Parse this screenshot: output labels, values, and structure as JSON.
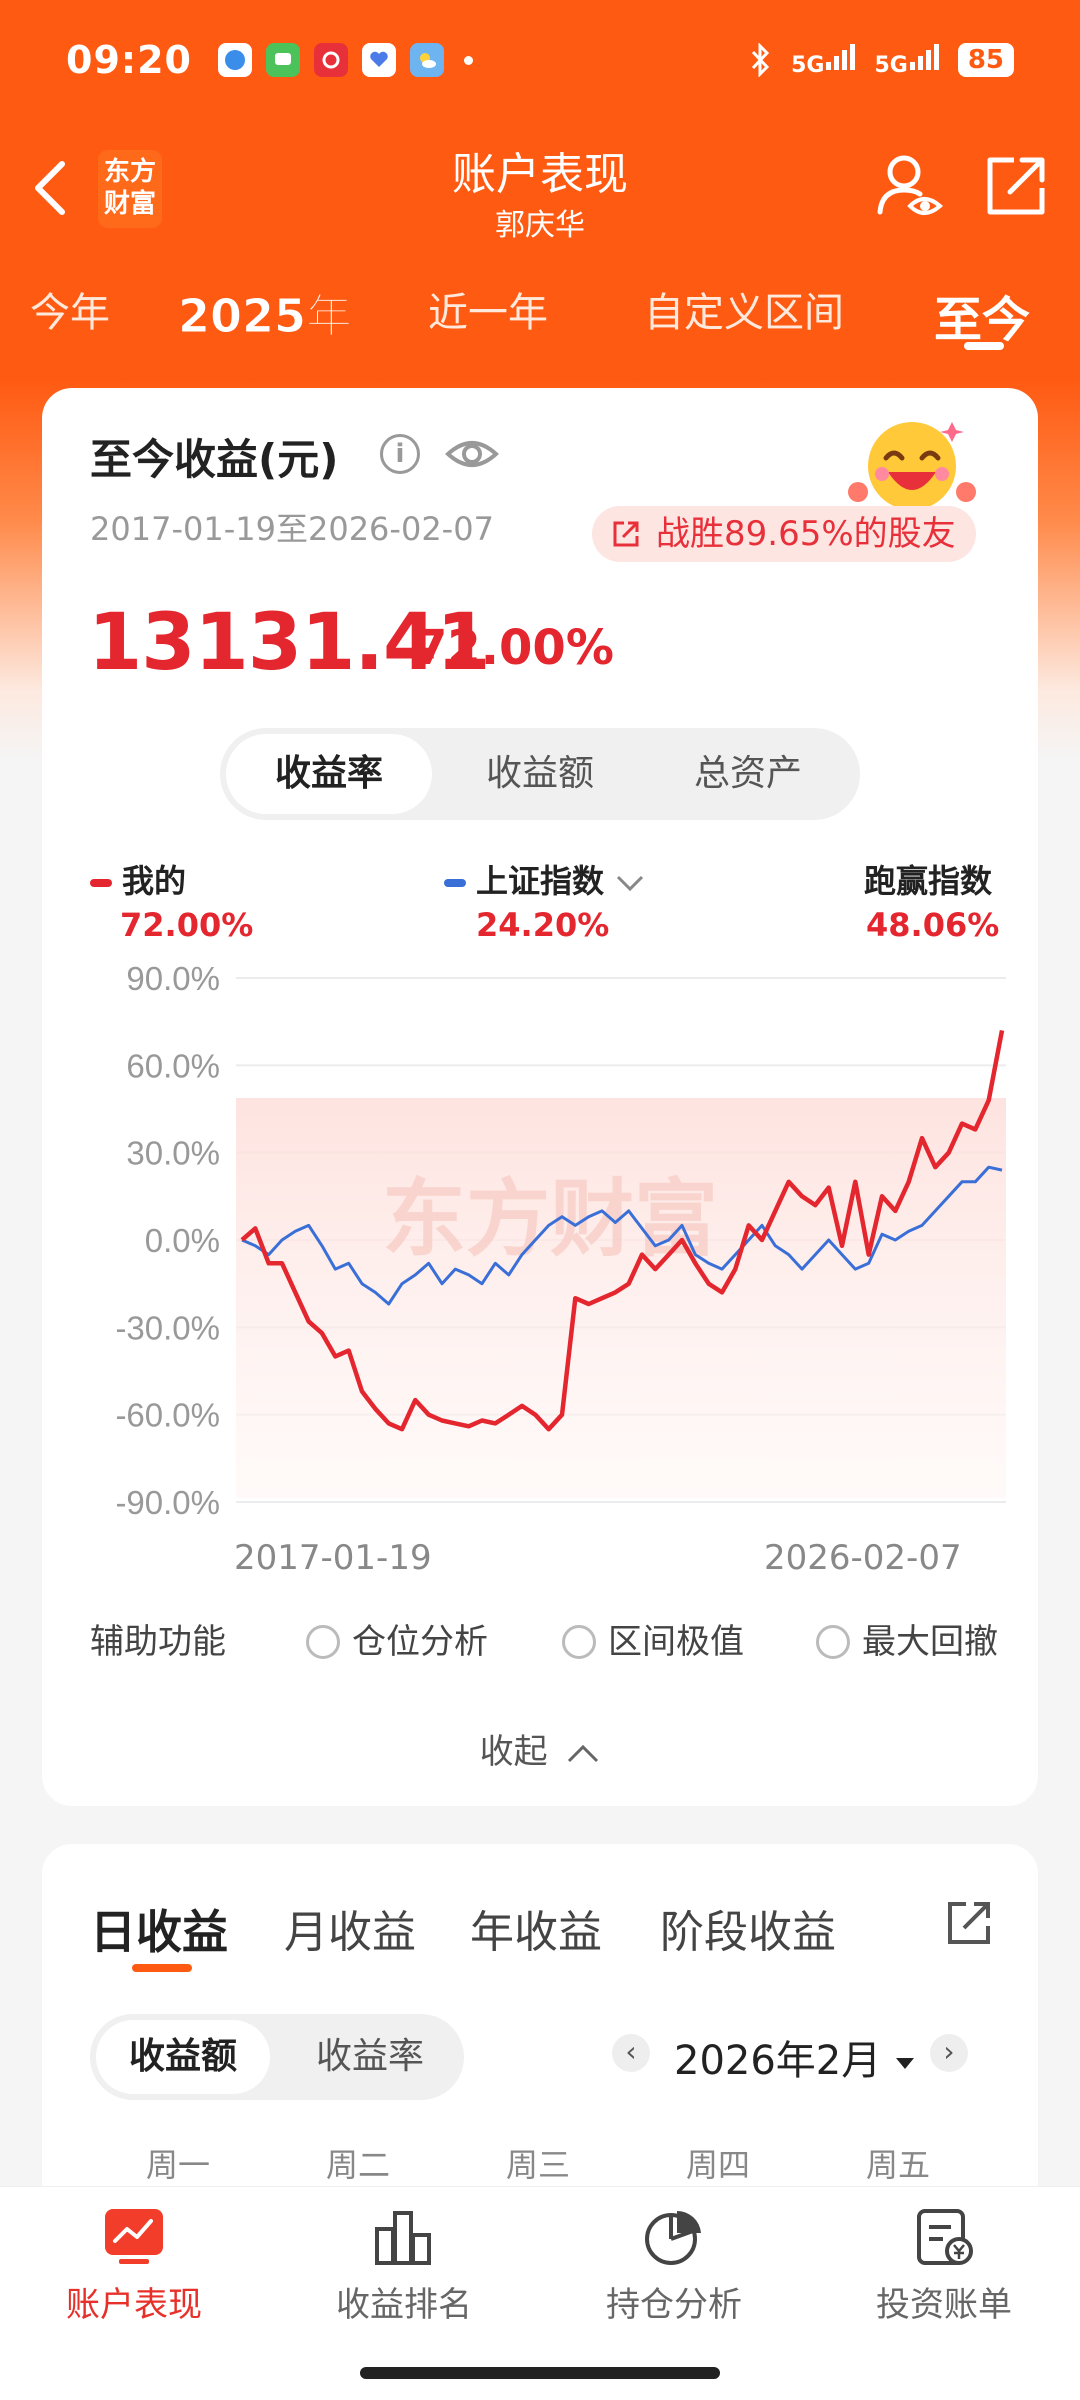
{
  "status_bar": {
    "time": "09:20",
    "signal_1": "5G",
    "signal_2": "5G",
    "battery": "85"
  },
  "header": {
    "back_icon": "back-chevron-icon",
    "logo_line1": "东方",
    "logo_line2": "财富",
    "title": "账户表现",
    "subtitle": "郭庆华"
  },
  "period_tabs": [
    "今年",
    "2025年",
    "近一年",
    "自定义区间",
    "至今"
  ],
  "summary": {
    "title": "至今收益(元)",
    "date_range": "2017-01-19至2026-02-07",
    "beat_text": "战胜89.65%的股友",
    "amount": "13131.41",
    "rate": "72.00%"
  },
  "metric_tabs": [
    "收益率",
    "收益额",
    "总资产"
  ],
  "legend": {
    "mine_label": "我的",
    "mine_value": "72.00%",
    "index_label": "上证指数",
    "index_value": "24.20%",
    "beat_label": "跑赢指数",
    "beat_value": "48.06%"
  },
  "colors": {
    "brand": "#ff5a12",
    "mine": "#e4262f",
    "index": "#3a6fd8"
  },
  "chart_data": {
    "type": "line",
    "ylim": [
      -90,
      90
    ],
    "yticks": [
      "90.0%",
      "60.0%",
      "30.0%",
      "0.0%",
      "-30.0%",
      "-60.0%",
      "-90.0%"
    ],
    "x_start_label": "2017-01-19",
    "x_end_label": "2026-02-07",
    "watermark": "东方财富",
    "series": [
      {
        "name": "我的",
        "values": [
          0,
          4,
          -8,
          -8,
          -18,
          -28,
          -32,
          -40,
          -38,
          -52,
          -58,
          -63,
          -65,
          -55,
          -60,
          -62,
          -63,
          -64,
          -62,
          -63,
          -60,
          -57,
          -60,
          -65,
          -60,
          -20,
          -22,
          -20,
          -18,
          -15,
          -5,
          -10,
          -5,
          0,
          -8,
          -15,
          -18,
          -10,
          5,
          0,
          10,
          20,
          15,
          12,
          18,
          -2,
          20,
          -5,
          15,
          10,
          20,
          35,
          25,
          30,
          40,
          38,
          48,
          72
        ]
      },
      {
        "name": "上证指数",
        "values": [
          0,
          -2,
          -5,
          0,
          3,
          5,
          -2,
          -10,
          -8,
          -15,
          -18,
          -22,
          -15,
          -12,
          -8,
          -15,
          -10,
          -12,
          -15,
          -8,
          -12,
          -5,
          0,
          5,
          8,
          5,
          8,
          10,
          6,
          10,
          4,
          -2,
          0,
          5,
          -5,
          -8,
          -10,
          -5,
          0,
          5,
          -2,
          -5,
          -10,
          -5,
          0,
          -5,
          -10,
          -8,
          2,
          0,
          3,
          5,
          10,
          15,
          20,
          20,
          25,
          24
        ]
      }
    ]
  },
  "aux": {
    "label": "辅助功能",
    "options": [
      "仓位分析",
      "区间极值",
      "最大回撤"
    ],
    "collapse": "收起"
  },
  "earnings": {
    "tabs": [
      "日收益",
      "月收益",
      "年收益",
      "阶段收益"
    ],
    "toggle": [
      "收益额",
      "收益率"
    ],
    "month": "2026年2月",
    "weekdays": [
      "周一",
      "周二",
      "周三",
      "周四",
      "周五"
    ]
  },
  "bottom_nav": [
    "账户表现",
    "收益排名",
    "持仓分析",
    "投资账单"
  ]
}
